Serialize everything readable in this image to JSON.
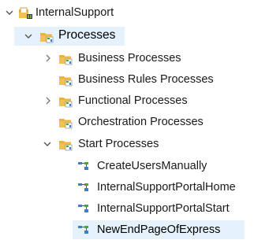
{
  "tree": {
    "root": {
      "label": "InternalSupport",
      "icon": "project-folder-icon",
      "expanded": true
    },
    "processes": {
      "label": "Processes",
      "icon": "process-folder-icon",
      "expanded": true
    },
    "children": [
      {
        "label": "Business Processes",
        "icon": "process-folder-icon",
        "expandable": true,
        "expanded": false
      },
      {
        "label": "Business Rules Processes",
        "icon": "process-folder-icon",
        "expandable": false,
        "expanded": false
      },
      {
        "label": "Functional Processes",
        "icon": "process-folder-icon",
        "expandable": true,
        "expanded": false
      },
      {
        "label": "Orchestration Processes",
        "icon": "process-folder-icon",
        "expandable": false,
        "expanded": false
      },
      {
        "label": "Start Processes",
        "icon": "process-folder-icon",
        "expandable": true,
        "expanded": true
      }
    ],
    "start_processes": [
      {
        "label": "CreateUsersManually",
        "icon": "process-icon"
      },
      {
        "label": "InternalSupportPortalHome",
        "icon": "process-icon"
      },
      {
        "label": "InternalSupportPortalStart",
        "icon": "process-icon"
      },
      {
        "label": "NewEndPageOfExpress",
        "icon": "process-icon",
        "selected": true
      }
    ]
  },
  "colors": {
    "folder": "#e8b23c",
    "folder_dark": "#c8871a",
    "accent_green": "#4aa63a",
    "accent_blue": "#3b7ed0",
    "selection": "#e5f1fb"
  }
}
